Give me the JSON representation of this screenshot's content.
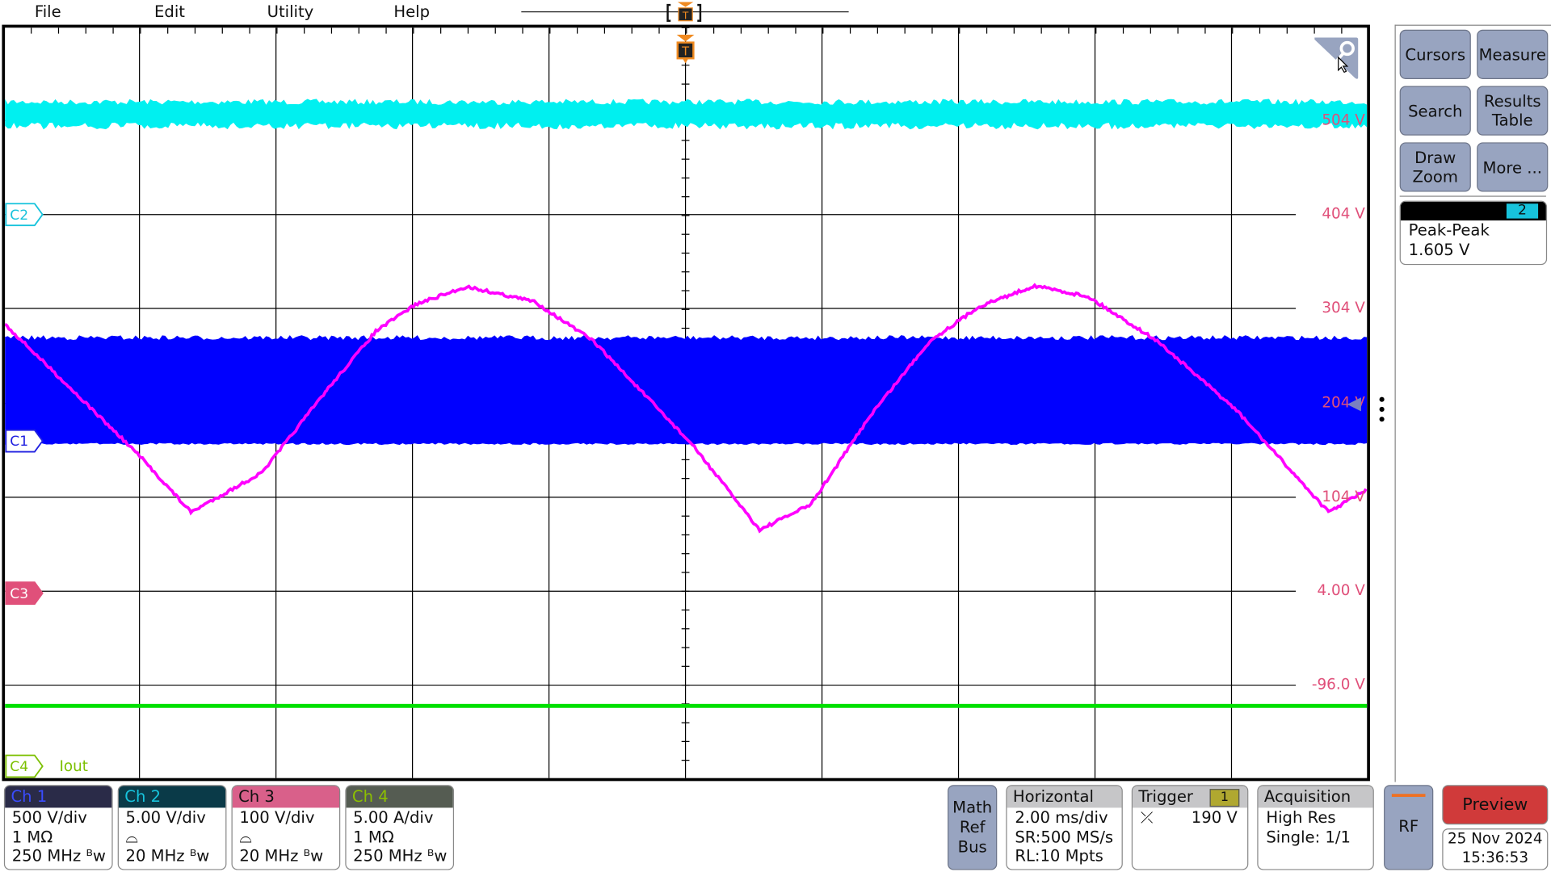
{
  "menu": {
    "items": [
      "File",
      "Edit",
      "Utility",
      "Help"
    ]
  },
  "trigger_marker": {
    "label": "T",
    "color": "#f08a20"
  },
  "side_panel": {
    "buttons": [
      "Cursors",
      "Measure",
      "Search",
      "Results\nTable",
      "Draw\nZoom",
      "More ..."
    ],
    "measurement": {
      "badge": "2",
      "name": "Peak-Peak",
      "value": "1.605 V",
      "badge_color": "#17c3dc"
    }
  },
  "graticule": {
    "scale_labels": [
      "504 V",
      "404 V",
      "304 V",
      "204 V",
      "104 V",
      "4.00 V",
      "-96.0 V"
    ],
    "channel_markers": [
      {
        "label": "C2",
        "color": "#17c3dc"
      },
      {
        "label": "C1",
        "color": "#2020e0"
      },
      {
        "label": "C3",
        "color": "#e0507a"
      },
      {
        "label": "C4",
        "color": "#7cc000"
      }
    ],
    "c4_name": "Iout",
    "colors": {
      "ch1": "#0000ff",
      "ch2": "#00f0f0",
      "ch3": "#ff00ff",
      "ch4": "#00e000"
    }
  },
  "channels": [
    {
      "title": "Ch 1",
      "lines": [
        "500 V/div",
        "1 MΩ",
        "250 MHz ᴮw"
      ],
      "header_bg": "#2a2b48",
      "title_color": "#3a4cff"
    },
    {
      "title": "Ch 2",
      "lines": [
        "5.00 V/div",
        "⌓",
        "20 MHz ᴮw"
      ],
      "header_bg": "#0a3a48",
      "title_color": "#17c3dc"
    },
    {
      "title": "Ch 3",
      "lines": [
        "100 V/div",
        "⌓",
        "20 MHz ᴮw"
      ],
      "header_bg": "#d9608a",
      "title_color": "#111"
    },
    {
      "title": "Ch 4",
      "lines": [
        "5.00 A/div",
        "1 MΩ",
        "250 MHz ᴮw"
      ],
      "header_bg": "#555c52",
      "title_color": "#8cc000"
    }
  ],
  "mrb": "Math\nRef\nBus",
  "horizontal": {
    "title": "Horizontal",
    "lines": [
      "2.00 ms/div",
      "SR:500 MS/s",
      "RL:10 Mpts"
    ]
  },
  "trigger": {
    "title": "Trigger",
    "source": "1",
    "level": "190 V"
  },
  "acquisition": {
    "title": "Acquisition",
    "lines": [
      "High Res",
      "Single: 1/1"
    ]
  },
  "rf": "RF",
  "preview": "Preview",
  "datetime": {
    "date": "25 Nov 2024",
    "time": "15:36:53"
  }
}
